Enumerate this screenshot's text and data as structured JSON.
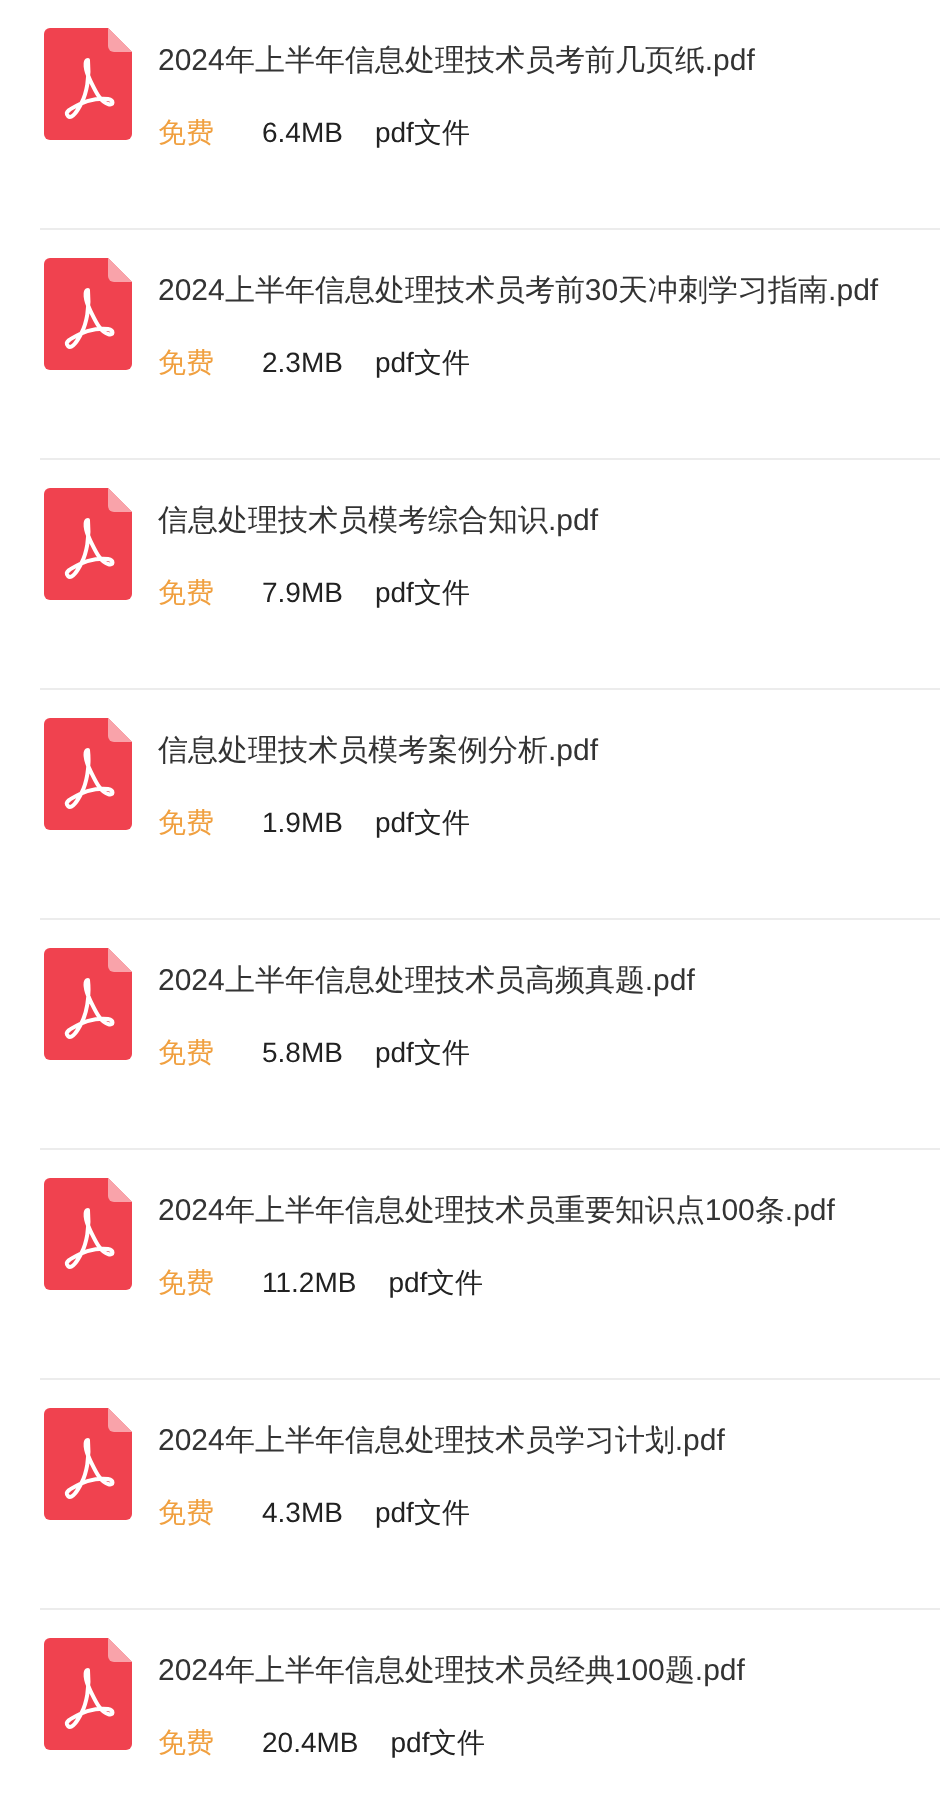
{
  "files": [
    {
      "name": "2024年上半年信息处理技术员考前几页纸.pdf",
      "price": "免费",
      "size": "6.4MB",
      "type": "pdf文件"
    },
    {
      "name": "2024上半年信息处理技术员考前30天冲刺学习指南.pdf",
      "price": "免费",
      "size": "2.3MB",
      "type": "pdf文件"
    },
    {
      "name": "信息处理技术员模考综合知识.pdf",
      "price": "免费",
      "size": "7.9MB",
      "type": "pdf文件"
    },
    {
      "name": "信息处理技术员模考案例分析.pdf",
      "price": "免费",
      "size": "1.9MB",
      "type": "pdf文件"
    },
    {
      "name": "2024上半年信息处理技术员高频真题.pdf",
      "price": "免费",
      "size": "5.8MB",
      "type": "pdf文件"
    },
    {
      "name": "2024年上半年信息处理技术员重要知识点100条.pdf",
      "price": "免费",
      "size": "11.2MB",
      "type": "pdf文件"
    },
    {
      "name": "2024年上半年信息处理技术员学习计划.pdf",
      "price": "免费",
      "size": "4.3MB",
      "type": "pdf文件"
    },
    {
      "name": "2024年上半年信息处理技术员经典100题.pdf",
      "price": "免费",
      "size": "20.4MB",
      "type": "pdf文件"
    }
  ]
}
